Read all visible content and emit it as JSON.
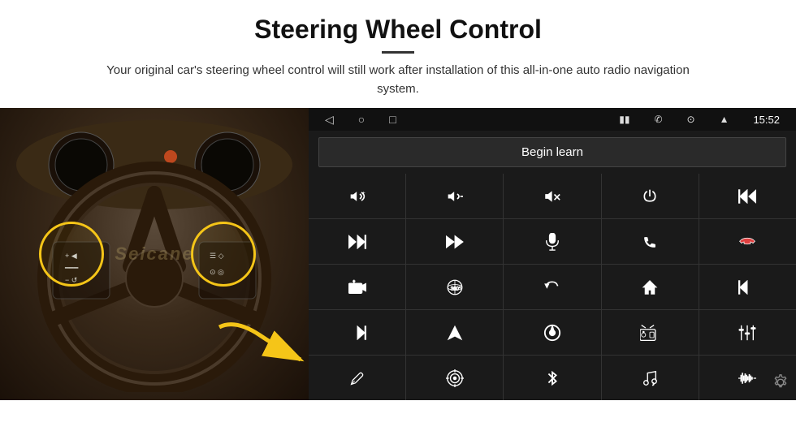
{
  "header": {
    "title": "Steering Wheel Control",
    "subtitle": "Your original car's steering wheel control will still work after installation of this all-in-one auto radio navigation system."
  },
  "status_bar": {
    "back_icon": "◁",
    "circle_icon": "○",
    "square_icon": "□",
    "signal_icon": "▮▮",
    "phone_icon": "✆",
    "location_icon": "⊙",
    "wifi_icon": "▲",
    "time": "15:52"
  },
  "begin_learn": {
    "label": "Begin learn"
  },
  "controls": [
    {
      "icon": "vol_up",
      "symbol": "🔊+"
    },
    {
      "icon": "vol_down",
      "symbol": "🔉−"
    },
    {
      "icon": "mute",
      "symbol": "🔇"
    },
    {
      "icon": "power",
      "symbol": "⏻"
    },
    {
      "icon": "prev_track",
      "symbol": "⏮"
    },
    {
      "icon": "next_track",
      "symbol": "⏭"
    },
    {
      "icon": "fast_prev",
      "symbol": "⏪"
    },
    {
      "icon": "mic",
      "symbol": "🎤"
    },
    {
      "icon": "phone",
      "symbol": "📞"
    },
    {
      "icon": "hang_up",
      "symbol": "📵"
    },
    {
      "icon": "camera",
      "symbol": "📷"
    },
    {
      "icon": "360_view",
      "symbol": "360°"
    },
    {
      "icon": "back",
      "symbol": "↩"
    },
    {
      "icon": "home",
      "symbol": "⌂"
    },
    {
      "icon": "skip_back",
      "symbol": "⏮⏮"
    },
    {
      "icon": "skip_fwd",
      "symbol": "⏭⏭"
    },
    {
      "icon": "navigate",
      "symbol": "▶"
    },
    {
      "icon": "source",
      "symbol": "⊕"
    },
    {
      "icon": "radio",
      "symbol": "📻"
    },
    {
      "icon": "equalizer",
      "symbol": "⫿"
    },
    {
      "icon": "pen",
      "symbol": "✎"
    },
    {
      "icon": "target",
      "symbol": "🎯"
    },
    {
      "icon": "bluetooth",
      "symbol": "⚡"
    },
    {
      "icon": "music",
      "symbol": "♪"
    },
    {
      "icon": "waveform",
      "symbol": "📊"
    }
  ],
  "watermark": "Seicane",
  "gear_icon": "⚙"
}
